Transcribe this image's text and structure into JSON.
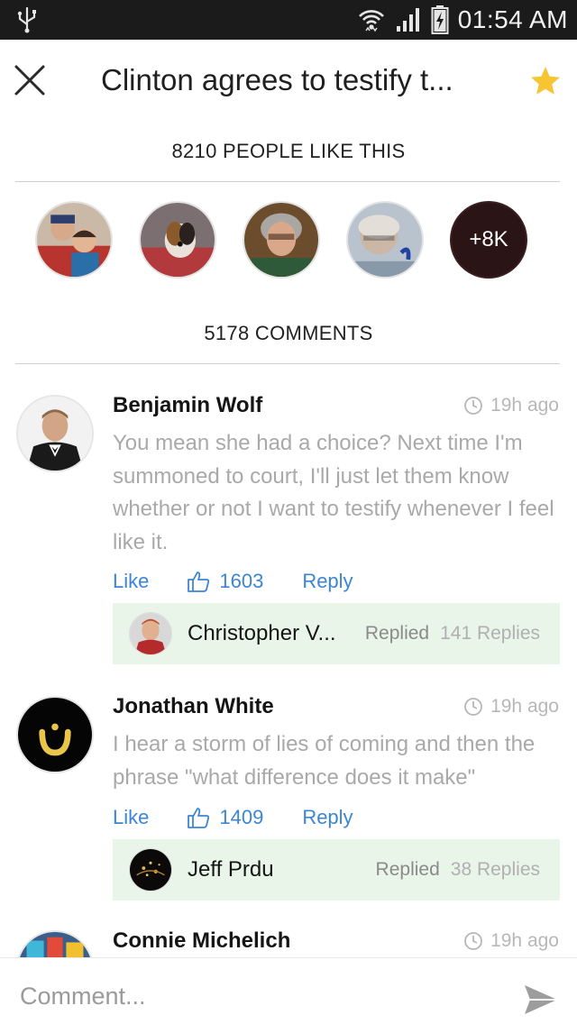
{
  "status_bar": {
    "time": "01:54 AM",
    "icons": [
      "usb-icon",
      "wifi-icon",
      "signal-icon",
      "battery-charging-icon"
    ]
  },
  "header": {
    "title": "Clinton agrees to testify t...",
    "close_icon": "close-icon",
    "star_icon": "star-icon",
    "star_color": "#f7c434"
  },
  "likes": {
    "label": "8210 PEOPLE LIKE THIS",
    "more_label": "+8K"
  },
  "comments_header": {
    "label": "5178 COMMENTS"
  },
  "comments": [
    {
      "author": "Benjamin Wolf",
      "time": "19h ago",
      "text": "You mean she had a choice? Next time I'm summoned to court, I'll just let them know whether or not I want to testify whenever I feel like it.",
      "like_label": "Like",
      "like_count": "1603",
      "reply_label": "Reply",
      "reply": {
        "name": "Christopher V...",
        "status": "Replied",
        "count": "141 Replies"
      }
    },
    {
      "author": "Jonathan White",
      "time": "19h ago",
      "text": "I hear a storm of lies of coming and then the phrase \"what difference does it make\"",
      "like_label": "Like",
      "like_count": "1409",
      "reply_label": "Reply",
      "reply": {
        "name": "Jeff Prdu",
        "status": "Replied",
        "count": "38 Replies"
      }
    },
    {
      "author": "Connie Michelich",
      "time": "19h ago"
    }
  ],
  "composer": {
    "placeholder": "Comment...",
    "send_icon": "send-icon"
  },
  "colors": {
    "link_blue": "#3c85d6",
    "reply_bg": "#e9f5e9",
    "status_bar_bg": "#1b1b1b"
  }
}
